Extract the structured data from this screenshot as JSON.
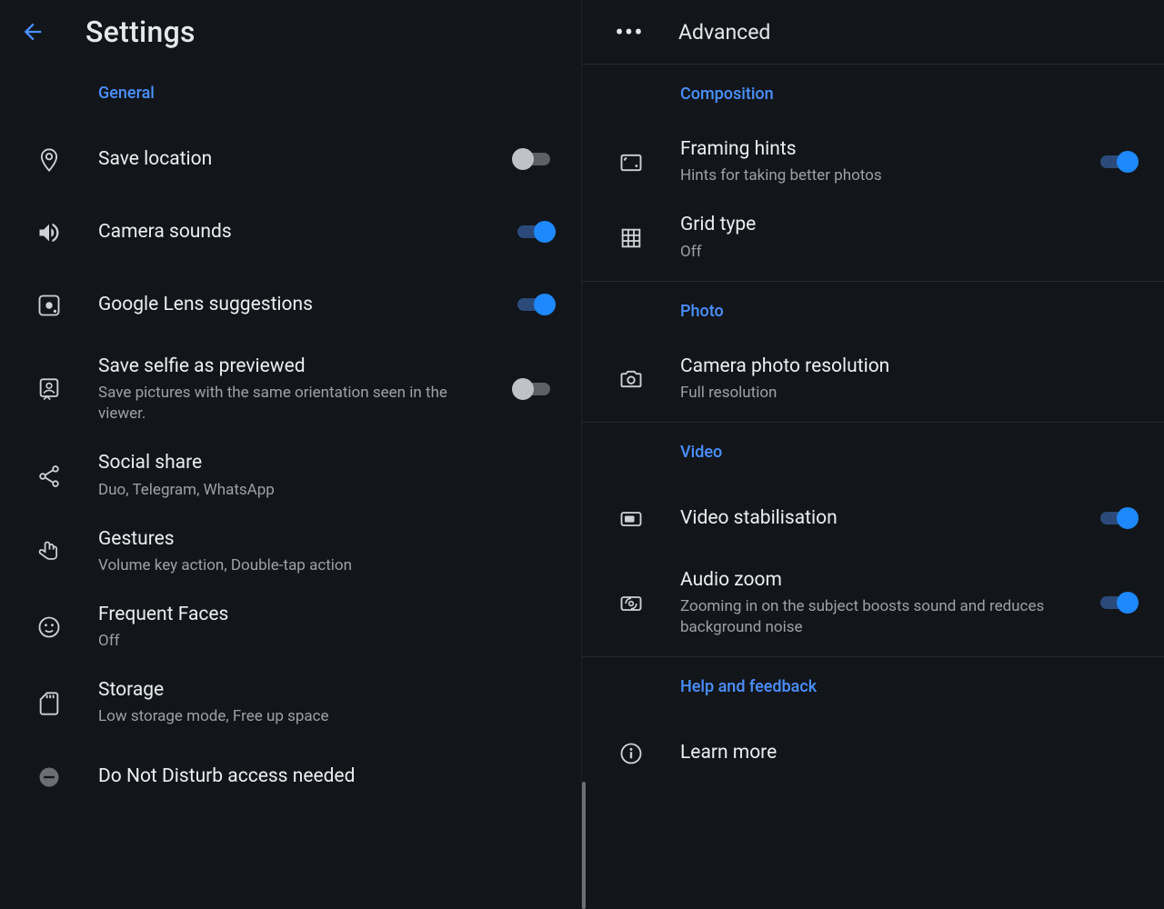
{
  "colors": {
    "accent": "#4a90ff",
    "switchOn": "#1e88ff",
    "bg": "#12161a",
    "text": "#e6e8ea",
    "sub": "#9da1a5"
  },
  "left": {
    "title": "Settings",
    "section_general": "General",
    "items": {
      "save_location": {
        "title": "Save location"
      },
      "camera_sounds": {
        "title": "Camera sounds"
      },
      "lens": {
        "title": "Google Lens suggestions"
      },
      "selfie": {
        "title": "Save selfie as previewed",
        "sub": "Save pictures with the same orientation seen in the viewer."
      },
      "social": {
        "title": "Social share",
        "sub": "Duo, Telegram, WhatsApp"
      },
      "gestures": {
        "title": "Gestures",
        "sub": "Volume key action, Double-tap action"
      },
      "faces": {
        "title": "Frequent Faces",
        "sub": "Off"
      },
      "storage": {
        "title": "Storage",
        "sub": "Low storage mode, Free up space"
      },
      "dnd": {
        "title": "Do Not Disturb access needed"
      }
    }
  },
  "right": {
    "advanced": "Advanced",
    "section_composition": "Composition",
    "section_photo": "Photo",
    "section_video": "Video",
    "section_help": "Help and feedback",
    "items": {
      "framing": {
        "title": "Framing hints",
        "sub": "Hints for taking better photos"
      },
      "grid": {
        "title": "Grid type",
        "sub": "Off"
      },
      "photo_res": {
        "title": "Camera photo resolution",
        "sub": "Full resolution"
      },
      "stab": {
        "title": "Video stabilisation"
      },
      "audio_zoom": {
        "title": "Audio zoom",
        "sub": "Zooming in on the subject boosts sound and reduces background noise"
      },
      "learn_more": {
        "title": "Learn more"
      }
    }
  }
}
